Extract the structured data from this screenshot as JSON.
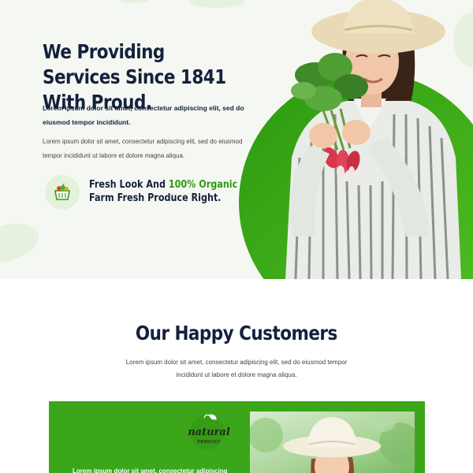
{
  "hero": {
    "title": "We Providing Services Since 1841 With Proud.",
    "lead": "Lorem ipsum dolor sit amet, consectetur adipiscing elit, sed do eiusmod tempor incididunt.",
    "body": "Lorem ipsum dolor sit amet, consectetur adipiscing elit, sed do eiusmod tempor incididunt ut labore et dolore magna aliqua.",
    "feature": {
      "icon": "produce-basket-icon",
      "text_before": "Fresh Look And ",
      "text_accent": "100% Organic",
      "text_after": " Farm Fresh Produce Right."
    }
  },
  "customers": {
    "title": "Our Happy Customers",
    "subtitle": "Lorem ipsum dolor sit amet, consectetur adipiscing elit, sed do eiusmod tempor incididunt ut labore et dolore magna aliqua.",
    "card": {
      "logo_text": "natural",
      "logo_subtext": "PRODUCT",
      "quote": "Lorem ipsum dolor sit amet, consectetur adipiscing"
    }
  },
  "colors": {
    "accent_green": "#2e9a13",
    "card_green": "#3ba61a",
    "navy": "#14213d",
    "hero_bg": "#f5f8f2"
  }
}
